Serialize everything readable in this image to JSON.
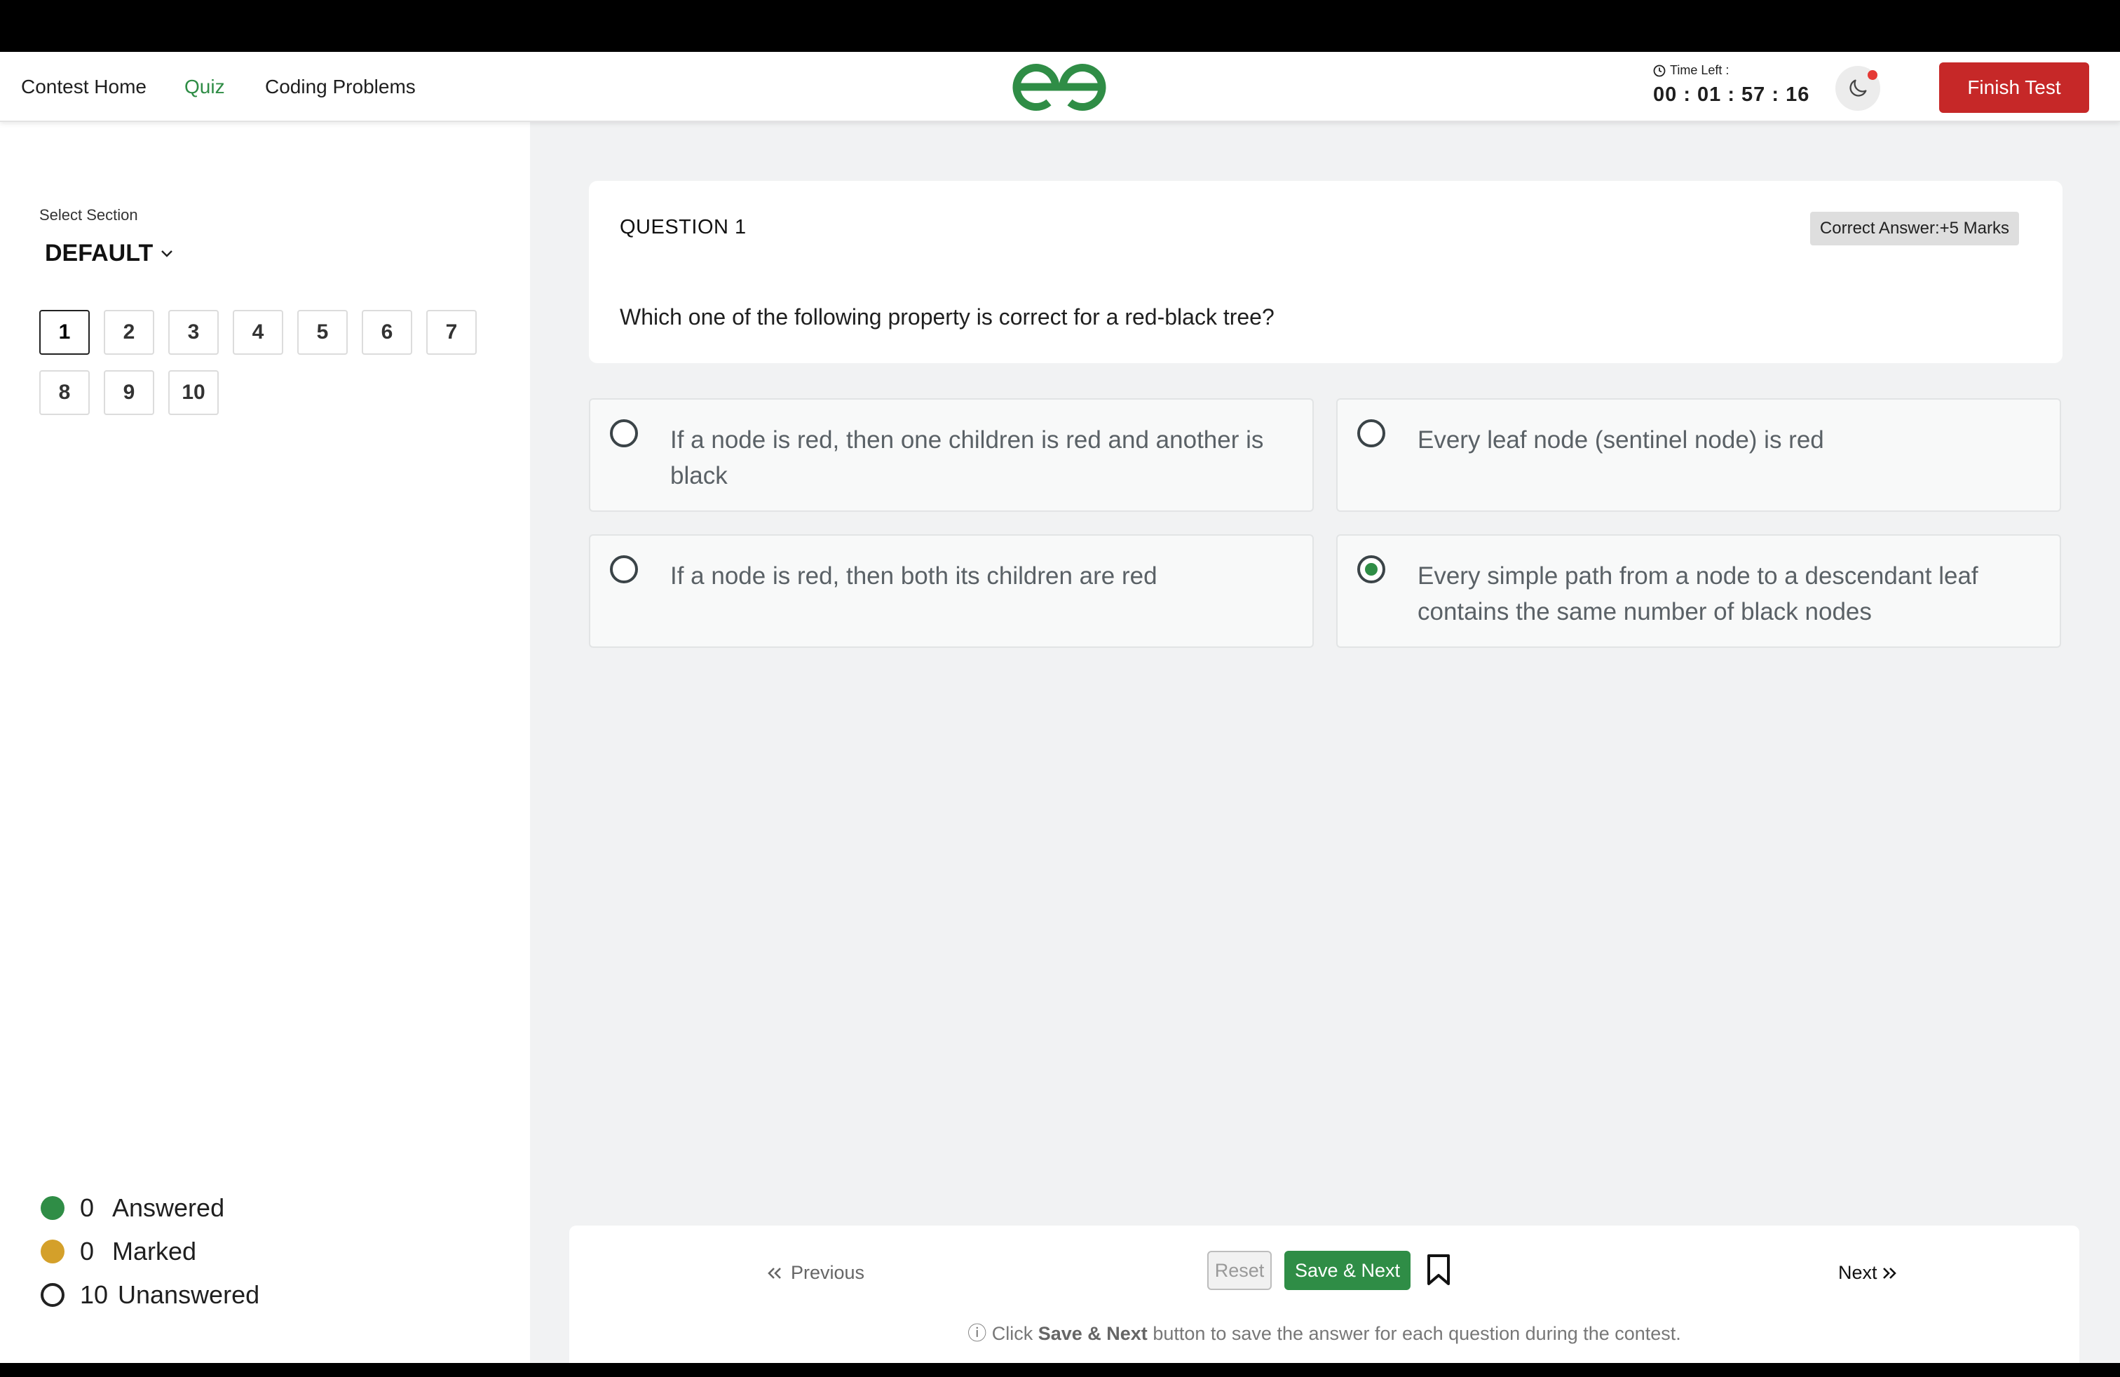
{
  "nav": {
    "contest_home": "Contest Home",
    "quiz": "Quiz",
    "coding_problems": "Coding Problems",
    "logo_icon": "gfg-logo-icon",
    "time_left_label": "Time Left :",
    "timer": "00 : 01 : 57 : 16",
    "finish_test": "Finish Test",
    "accent_color": "#2f8d46",
    "finish_color": "#c62828"
  },
  "sidebar": {
    "select_section_label": "Select Section",
    "section": "DEFAULT",
    "questions": [
      "1",
      "2",
      "3",
      "4",
      "5",
      "6",
      "7",
      "8",
      "9",
      "10"
    ],
    "current_question": "1",
    "legend": {
      "answered_count": "0",
      "answered_label": "Answered",
      "marked_count": "0",
      "marked_label": "Marked",
      "unanswered_count": "10",
      "unanswered_label": "Unanswered",
      "answered_color": "#2f8d46",
      "marked_color": "#d4a02a"
    }
  },
  "question": {
    "number_label": "QUESTION 1",
    "marks_badge": "Correct Answer:+5 Marks",
    "text": "Which one of the following property is correct for a red-black tree?",
    "options": [
      {
        "text": "If a node is red, then one children is red and another is black",
        "selected": false
      },
      {
        "text": "Every leaf node (sentinel node) is red",
        "selected": false
      },
      {
        "text": "If a node is red, then both its children are red",
        "selected": false
      },
      {
        "text": "Every simple path from a node to a descendant leaf contains the same number of black nodes",
        "selected": true
      }
    ]
  },
  "footer": {
    "previous": "Previous",
    "reset": "Reset",
    "save_next": "Save & Next",
    "next": "Next",
    "info_prefix": "Click",
    "info_bold": "Save & Next",
    "info_suffix": "button to save the answer for each question during the contest."
  }
}
